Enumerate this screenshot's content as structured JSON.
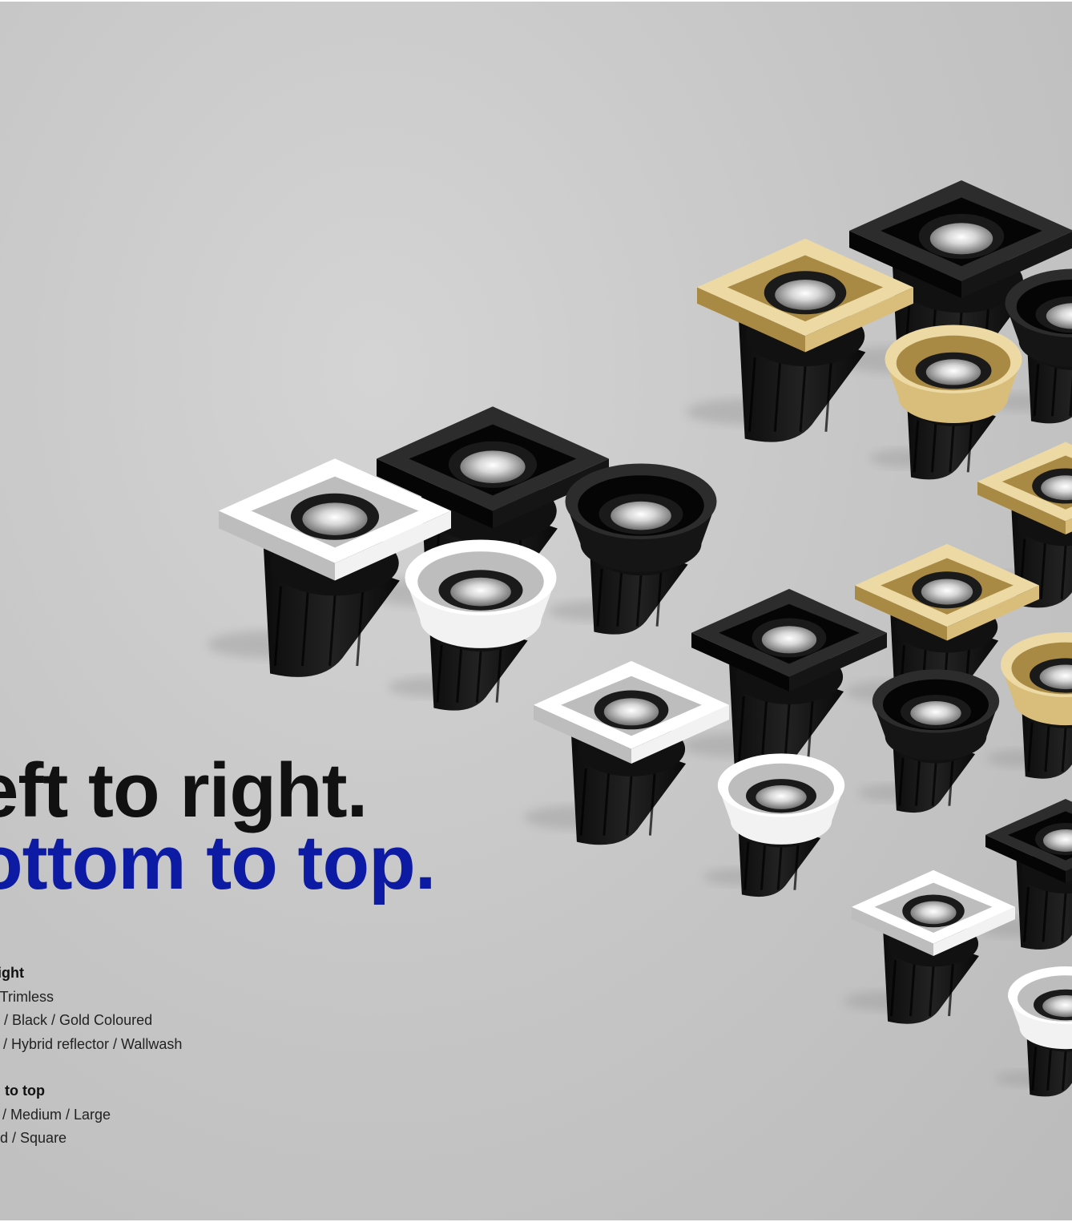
{
  "headline": {
    "line1": "eft to right.",
    "line2": "ottom to top.",
    "line1_color": "#111111",
    "line2_color": "#0d1aa3"
  },
  "legend": {
    "left_to_right": {
      "heading": "right",
      "lines": [
        "/ Trimless",
        "e / Black / Gold Coloured",
        "s / Hybrid reflector / Wallwash"
      ]
    },
    "bottom_to_top": {
      "heading": "n to top",
      "lines": [
        "ll / Medium / Large",
        "nd / Square"
      ]
    }
  },
  "colors": {
    "background": "#c6c6c6",
    "finish_white": "#f2f2f2",
    "finish_black": "#151515",
    "finish_gold": "#d9bd7a"
  },
  "products": [
    {
      "trim": "square",
      "finish": "white"
    },
    {
      "trim": "square",
      "finish": "black"
    },
    {
      "trim": "round",
      "finish": "white"
    },
    {
      "trim": "round",
      "finish": "black"
    },
    {
      "trim": "square",
      "finish": "white"
    },
    {
      "trim": "square",
      "finish": "black"
    },
    {
      "trim": "round",
      "finish": "white"
    },
    {
      "trim": "round",
      "finish": "black"
    },
    {
      "trim": "square",
      "finish": "white"
    },
    {
      "trim": "square",
      "finish": "gold"
    },
    {
      "trim": "square",
      "finish": "black"
    },
    {
      "trim": "round",
      "finish": "gold"
    },
    {
      "trim": "round",
      "finish": "black"
    },
    {
      "trim": "square",
      "finish": "gold"
    },
    {
      "trim": "square",
      "finish": "gold"
    },
    {
      "trim": "round",
      "finish": "gold"
    },
    {
      "trim": "square",
      "finish": "black"
    },
    {
      "trim": "round",
      "finish": "white"
    }
  ]
}
